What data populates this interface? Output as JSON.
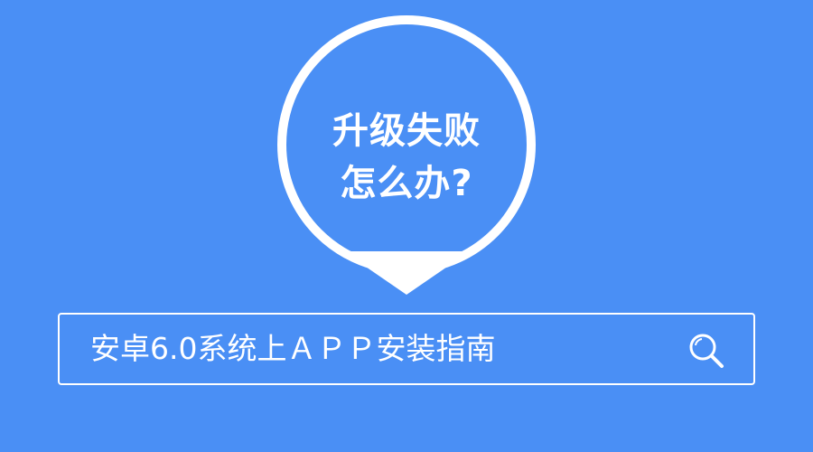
{
  "pin": {
    "line1": "升级失败",
    "line2": "怎么办?"
  },
  "search": {
    "text": "安卓6.0系统上ＡＰＰ安装指南",
    "icon": "search-icon"
  },
  "colors": {
    "background": "#4a8ff5",
    "foreground": "#ffffff"
  }
}
